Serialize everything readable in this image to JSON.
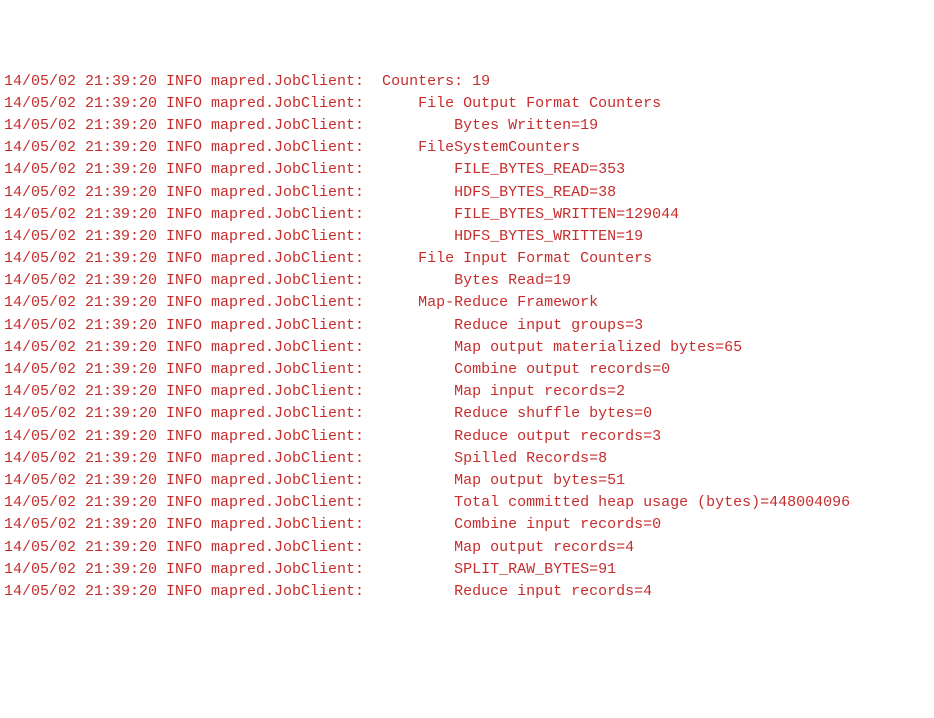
{
  "timestamp": "14/05/02 21:39:20",
  "level": "INFO",
  "source": "mapred.JobClient:",
  "lines": [
    {
      "indent": 1,
      "text": "Counters: 19"
    },
    {
      "indent": 3,
      "text": "File Output Format Counters "
    },
    {
      "indent": 5,
      "text": "Bytes Written=19"
    },
    {
      "indent": 3,
      "text": "FileSystemCounters"
    },
    {
      "indent": 5,
      "text": "FILE_BYTES_READ=353"
    },
    {
      "indent": 5,
      "text": "HDFS_BYTES_READ=38"
    },
    {
      "indent": 5,
      "text": "FILE_BYTES_WRITTEN=129044"
    },
    {
      "indent": 5,
      "text": "HDFS_BYTES_WRITTEN=19"
    },
    {
      "indent": 3,
      "text": "File Input Format Counters "
    },
    {
      "indent": 5,
      "text": "Bytes Read=19"
    },
    {
      "indent": 3,
      "text": "Map-Reduce Framework"
    },
    {
      "indent": 5,
      "text": "Reduce input groups=3"
    },
    {
      "indent": 5,
      "text": "Map output materialized bytes=65"
    },
    {
      "indent": 5,
      "text": "Combine output records=0"
    },
    {
      "indent": 5,
      "text": "Map input records=2"
    },
    {
      "indent": 5,
      "text": "Reduce shuffle bytes=0"
    },
    {
      "indent": 5,
      "text": "Reduce output records=3"
    },
    {
      "indent": 5,
      "text": "Spilled Records=8"
    },
    {
      "indent": 5,
      "text": "Map output bytes=51"
    },
    {
      "indent": 5,
      "text": "Total committed heap usage (bytes)=448004096"
    },
    {
      "indent": 5,
      "text": "Combine input records=0"
    },
    {
      "indent": 5,
      "text": "Map output records=4"
    },
    {
      "indent": 5,
      "text": "SPLIT_RAW_BYTES=91"
    },
    {
      "indent": 5,
      "text": "Reduce input records=4"
    }
  ]
}
